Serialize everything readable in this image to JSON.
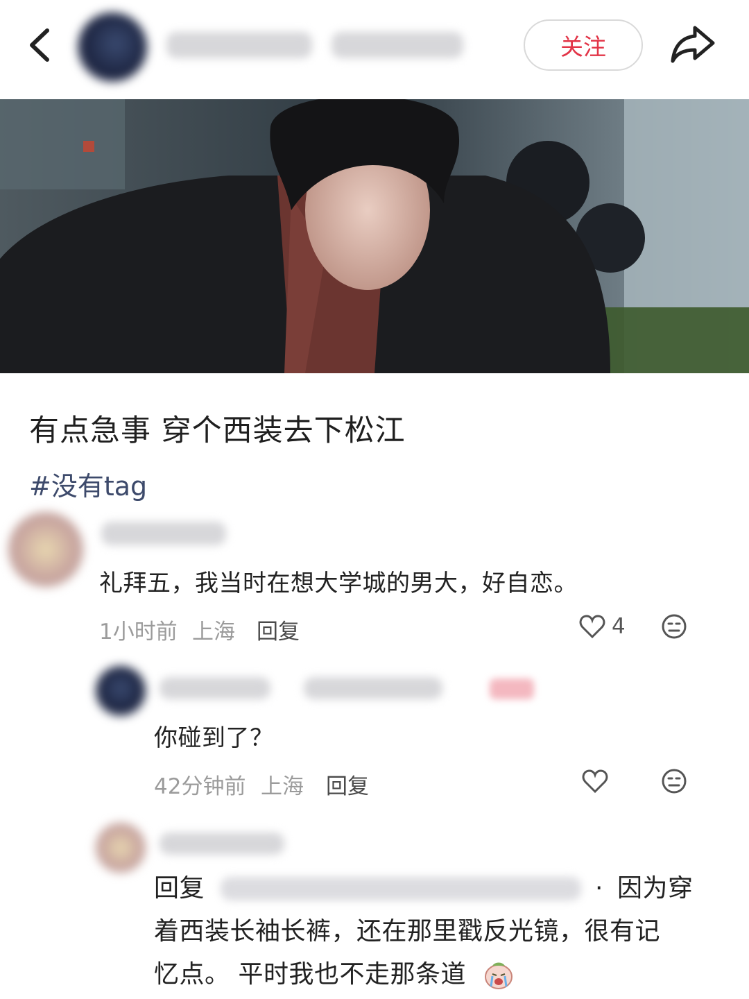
{
  "header": {
    "follow_label": "关注"
  },
  "post": {
    "title": "有点急事 穿个西装去下松江",
    "hashtag": "#没有tag"
  },
  "comments": [
    {
      "text": "礼拜五，我当时在想大学城的男大，好自恋。",
      "time": "1小时前",
      "location": "上海",
      "reply_label": "回复",
      "like_count": "4"
    },
    {
      "text": "你碰到了？",
      "time": "42分钟前",
      "location": "上海",
      "reply_label": "回复"
    },
    {
      "reply_prefix": "回复",
      "separator": "·",
      "line1_tail": "因为穿",
      "line2": "着西装长袖长裤，还在那里戳反光镜，很有记",
      "line3": "忆点。 平时我也不走那条道"
    }
  ],
  "colors": {
    "accent": "#e23447",
    "hashtag": "#3d4a6b"
  },
  "icons": [
    "chevron-left-icon",
    "share-icon",
    "heart-icon",
    "emoji-icon",
    "crying-emoji-icon"
  ]
}
